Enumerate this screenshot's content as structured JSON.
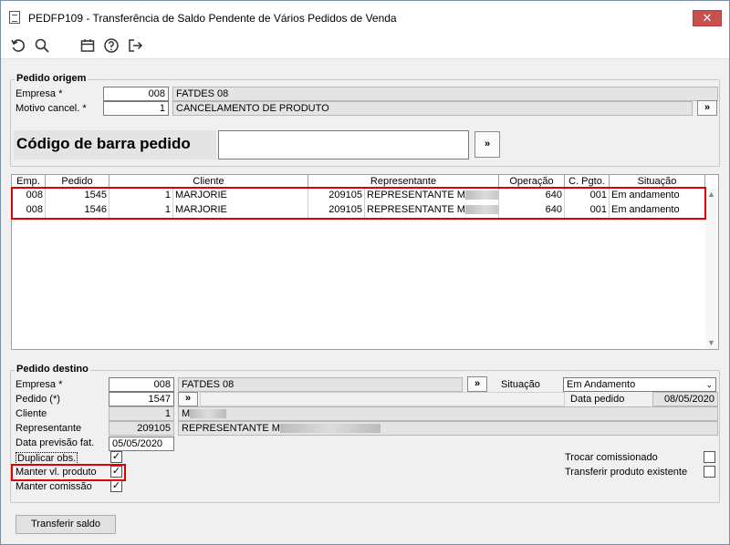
{
  "window": {
    "title": "PEDFP109 - Transferência de Saldo Pendente de Vários Pedidos de Venda",
    "close_glyph": "✕"
  },
  "toolbar": {
    "icons": [
      "undo-icon",
      "search-icon",
      "calendar-icon",
      "help-icon",
      "exit-icon"
    ]
  },
  "origem": {
    "legend": "Pedido origem",
    "empresa_label": "Empresa *",
    "empresa_code": "008",
    "empresa_name": "FATDES 08",
    "motivo_label": "Motivo cancel. *",
    "motivo_code": "1",
    "motivo_name": "CANCELAMENTO DE PRODUTO",
    "barcode_label": "Código de barra pedido",
    "barcode_value": ""
  },
  "grid": {
    "headers": [
      "Emp.",
      "Pedido",
      "Cliente",
      "Representante",
      "Operação",
      "C. Pgto.",
      "Situação"
    ],
    "rows": [
      {
        "emp": "008",
        "pedido": "1545",
        "cli_code": "1",
        "cli_name": "MARJORIE",
        "rep_code": "209105",
        "rep_name": "REPRESENTANTE M",
        "operacao": "640",
        "cpgto": "001",
        "situacao": "Em andamento"
      },
      {
        "emp": "008",
        "pedido": "1546",
        "cli_code": "1",
        "cli_name": "MARJORIE",
        "rep_code": "209105",
        "rep_name": "REPRESENTANTE M",
        "operacao": "640",
        "cpgto": "001",
        "situacao": "Em andamento"
      }
    ]
  },
  "destino": {
    "legend": "Pedido destino",
    "empresa_label": "Empresa *",
    "empresa_code": "008",
    "empresa_name": "FATDES 08",
    "situacao_label": "Situação",
    "situacao_value": "Em Andamento",
    "pedido_label": "Pedido (*)",
    "pedido_value": "1547",
    "data_pedido_label": "Data pedido",
    "data_pedido_value": "08/05/2020",
    "cliente_label": "Cliente",
    "cliente_code": "1",
    "cliente_name": "M",
    "representante_label": "Representante",
    "representante_code": "209105",
    "representante_name": "REPRESENTANTE M",
    "previsao_label": "Data previsão fat.",
    "previsao_value": "05/05/2020",
    "duplicar_label": "Duplicar obs.",
    "manter_vl_label": "Manter vl. produto",
    "manter_comissao_label": "Manter comissão",
    "trocar_label": "Trocar comissionado",
    "transferir_label": "Transferir produto existente",
    "check_glyph": "✓"
  },
  "actions": {
    "transferir_saldo": "Transferir saldo",
    "search_glyph": "»"
  }
}
